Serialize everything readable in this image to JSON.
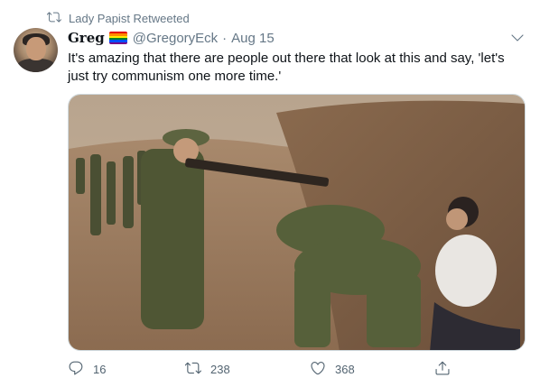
{
  "retweet_notice": {
    "icon": "retweet-icon",
    "text": "Lady Papist Retweeted"
  },
  "author": {
    "name": "Greg",
    "badge": "rainbow-flag",
    "handle": "@GregoryEck",
    "separator": "·",
    "date": "Aug 15"
  },
  "tweet": {
    "text_line1": "It's amazing that there are people out there that look at this and say, 'let's",
    "text_line2": "just try communism one more time.'"
  },
  "actions": {
    "reply_count": "16",
    "retweet_count": "238",
    "like_count": "368"
  },
  "colors": {
    "muted": "#657786",
    "text": "#0f1419",
    "border": "#cfd9de"
  }
}
